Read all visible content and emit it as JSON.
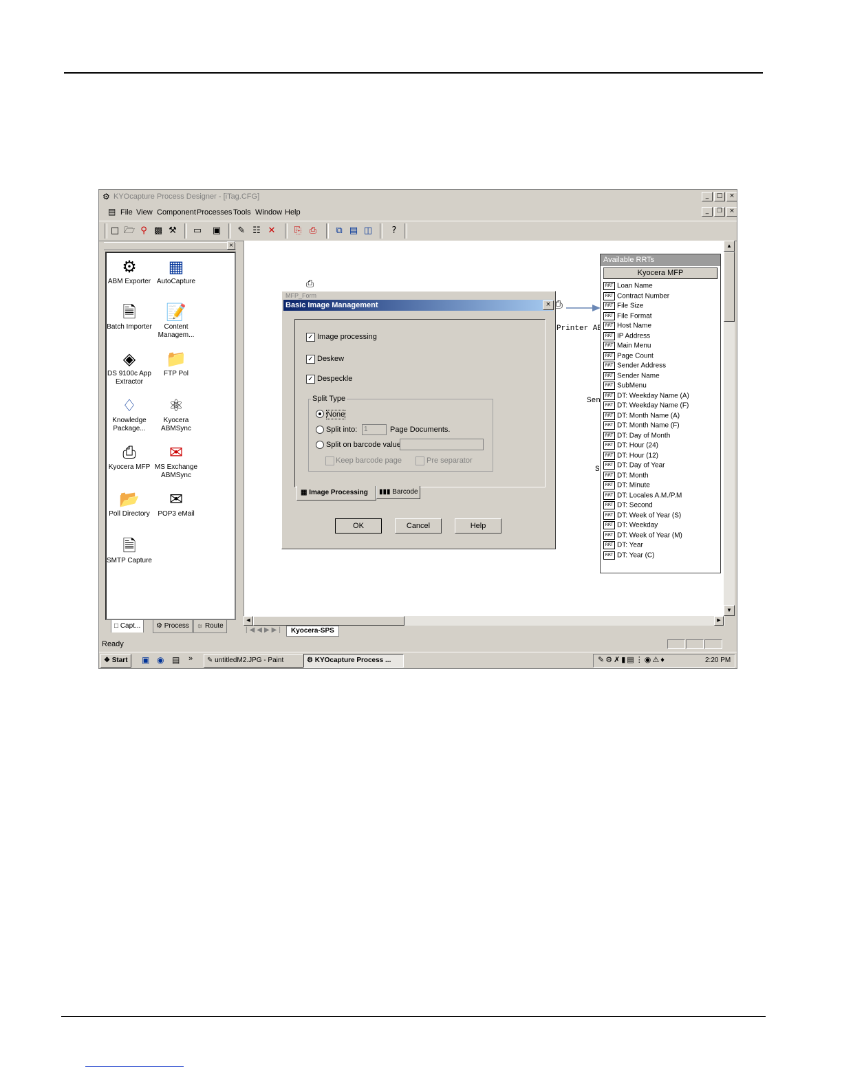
{
  "app": {
    "title": "KYOcapture Process Designer - [iTag.CFG]",
    "menu": [
      "File",
      "View",
      "Component",
      "Processes",
      "Tools",
      "Window",
      "Help"
    ]
  },
  "palette": {
    "items": [
      {
        "label": "ABM Exporter",
        "icon": "abm-exporter-icon"
      },
      {
        "label": "AutoCapture",
        "icon": "autocapture-icon"
      },
      {
        "label": "Batch Importer",
        "icon": "batch-importer-icon"
      },
      {
        "label": "Content Managem...",
        "icon": "content-management-icon"
      },
      {
        "label": "DS 9100c App Extractor",
        "icon": "ds9100c-icon"
      },
      {
        "label": "FTP Pol",
        "icon": "ftp-icon"
      },
      {
        "label": "Knowledge Package...",
        "icon": "knowledge-package-icon"
      },
      {
        "label": "Kyocera ABMSync",
        "icon": "abmsync-icon"
      },
      {
        "label": "Kyocera MFP",
        "icon": "mfp-icon"
      },
      {
        "label": "MS Exchange ABMSync",
        "icon": "ms-exchange-icon"
      },
      {
        "label": "Poll Directory",
        "icon": "folder-icon"
      },
      {
        "label": "POP3 eMail",
        "icon": "pop3-icon"
      },
      {
        "label": "SMTP Capture",
        "icon": "smtp-icon"
      }
    ],
    "tabs": [
      "Capt...",
      "Process",
      "Route"
    ]
  },
  "canvas": {
    "node_label": "MFP_Form",
    "printer_label": "Printer ABBY",
    "fragment_1": "Sen",
    "fragment_2": "S",
    "sheet_tab": "Kyocera-SPS"
  },
  "rrt_panel": {
    "header": "Available RRTs",
    "selected": "Kyocera MFP",
    "badge": "RRT",
    "items": [
      "Loan Name",
      "Contract Number",
      "File Size",
      "File Format",
      "Host Name",
      "IP Address",
      "Main Menu",
      "Page Count",
      "Sender Address",
      "Sender Name",
      "SubMenu",
      "DT: Weekday Name (A)",
      "DT: Weekday Name (F)",
      "DT: Month Name (A)",
      "DT: Month Name (F)",
      "DT: Day of Month",
      "DT: Hour (24)",
      "DT: Hour (12)",
      "DT: Day of Year",
      "DT: Month",
      "DT: Minute",
      "DT: Locales A.M./P.M",
      "DT: Second",
      "DT: Week of Year (S)",
      "DT: Weekday",
      "DT: Week of Year (M)",
      "DT: Year",
      "DT: Year (C)"
    ]
  },
  "dialog": {
    "title": "Basic Image Management",
    "image_processing": "Image processing",
    "deskew": "Deskew",
    "despeckle": "Despeckle",
    "split_type": "Split Type",
    "none": "None",
    "split_into": "Split into:",
    "split_into_value": "1",
    "page_documents": "Page Documents.",
    "split_barcode": "Split on barcode value",
    "keep_barcode": "Keep barcode page",
    "pre_separator": "Pre separator",
    "tab_image_processing": "Image Processing",
    "tab_barcode": "Barcode",
    "ok": "OK",
    "cancel": "Cancel",
    "help": "Help"
  },
  "status": {
    "text": "Ready"
  },
  "taskbar": {
    "start": "Start",
    "task_paint": "untitledM2.JPG - Paint",
    "task_kyo": "KYOcapture Process ...",
    "clock": "2:20 PM"
  }
}
